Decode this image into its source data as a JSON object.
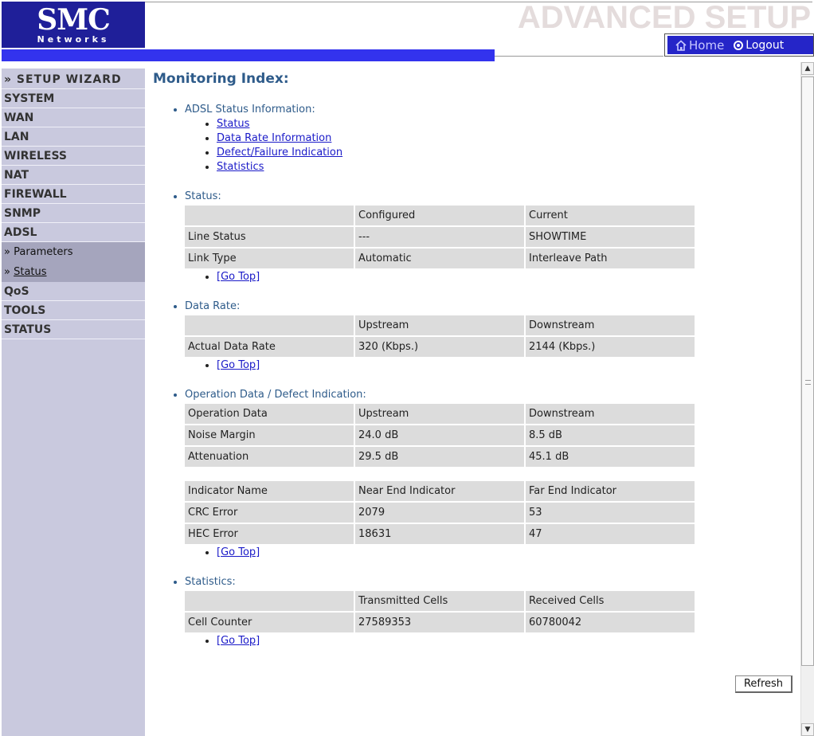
{
  "logo": {
    "brand": "SMC",
    "sub": "Networks"
  },
  "header": {
    "title": "ADVANCED SETUP"
  },
  "top_nav": {
    "home": "Home",
    "logout": "Logout"
  },
  "sidebar": {
    "items": [
      {
        "id": "setup-wizard",
        "label": "» SETUP WIZARD"
      },
      {
        "id": "system",
        "label": "SYSTEM"
      },
      {
        "id": "wan",
        "label": "WAN"
      },
      {
        "id": "lan",
        "label": "LAN"
      },
      {
        "id": "wireless",
        "label": "WIRELESS"
      },
      {
        "id": "nat",
        "label": "NAT"
      },
      {
        "id": "firewall",
        "label": "FIREWALL"
      },
      {
        "id": "snmp",
        "label": "SNMP"
      },
      {
        "id": "adsl",
        "label": "ADSL"
      }
    ],
    "sub_items": [
      {
        "prefix": "» ",
        "label": "Parameters"
      },
      {
        "prefix": "» ",
        "label": "Status"
      }
    ],
    "items_after": [
      {
        "id": "qos",
        "label": "QoS"
      },
      {
        "id": "tools",
        "label": "TOOLS"
      },
      {
        "id": "status",
        "label": "STATUS"
      }
    ]
  },
  "main": {
    "title": "Monitoring Index:",
    "index_label": "ADSL Status Information:",
    "index_links": [
      "Status",
      "Data Rate Information",
      "Defect/Failure Indication",
      "Statistics"
    ],
    "go_top": "[Go Top]",
    "status": {
      "label": "Status:",
      "headers": [
        "",
        "Configured",
        "Current"
      ],
      "rows": [
        [
          "Line Status",
          "---",
          "SHOWTIME"
        ],
        [
          "Link Type",
          "Automatic",
          "Interleave Path"
        ]
      ]
    },
    "data_rate": {
      "label": "Data Rate:",
      "headers": [
        "",
        "Upstream",
        "Downstream"
      ],
      "rows": [
        [
          "Actual Data Rate",
          "320 (Kbps.)",
          "2144 (Kbps.)"
        ]
      ]
    },
    "operation": {
      "label": "Operation Data / Defect Indication:",
      "headers": [
        "Operation Data",
        "Upstream",
        "Downstream"
      ],
      "rows": [
        [
          "Noise Margin",
          "24.0 dB",
          "8.5 dB"
        ],
        [
          "Attenuation",
          "29.5 dB",
          "45.1 dB"
        ]
      ],
      "indicator_headers": [
        "Indicator Name",
        "Near End Indicator",
        "Far End Indicator"
      ],
      "indicator_rows": [
        [
          "CRC Error",
          "2079",
          "53"
        ],
        [
          "HEC Error",
          "18631",
          "47"
        ]
      ]
    },
    "statistics": {
      "label": "Statistics:",
      "headers": [
        "",
        "Transmitted Cells",
        "Received Cells"
      ],
      "rows": [
        [
          "Cell Counter",
          "27589353",
          "60780042"
        ]
      ]
    },
    "refresh_label": "Refresh"
  }
}
